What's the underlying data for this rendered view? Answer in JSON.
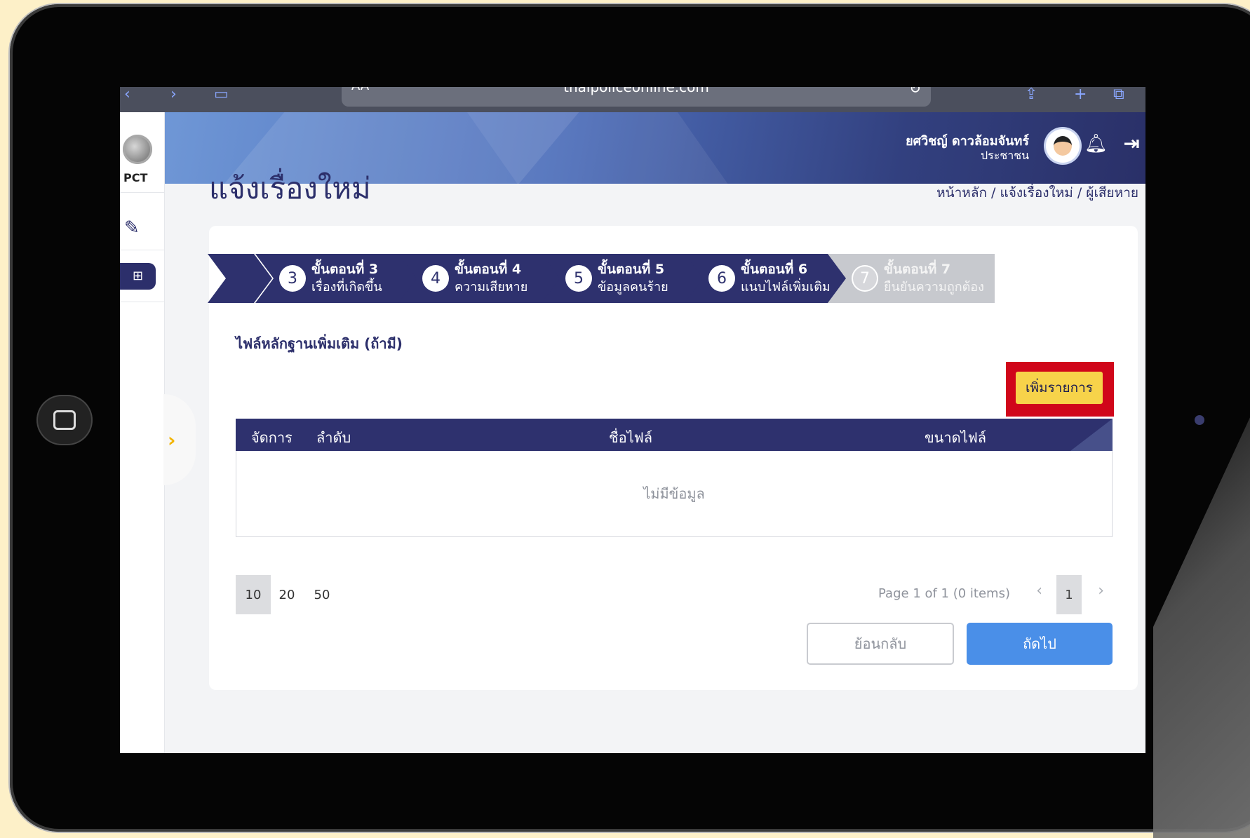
{
  "browser": {
    "text_size_label": "AA",
    "url": "thaipoliceonline.com"
  },
  "sidebar": {
    "logo_label": "PCT"
  },
  "header": {
    "user_name": "ยศวิชญ์ ดาวล้อมจันทร์",
    "user_role": "ประชาชน"
  },
  "page": {
    "title": "แจ้งเรื่องใหม่",
    "breadcrumb": "หน้าหลัก / แจ้งเรื่องใหม่ / ผู้เสียหาย"
  },
  "stepper": {
    "steps": [
      {
        "number": "3",
        "title": "ขั้นตอนที่ 3",
        "subtitle": "เรื่องที่เกิดขึ้น",
        "state": "done"
      },
      {
        "number": "4",
        "title": "ขั้นตอนที่ 4",
        "subtitle": "ความเสียหาย",
        "state": "done"
      },
      {
        "number": "5",
        "title": "ขั้นตอนที่ 5",
        "subtitle": "ข้อมูลคนร้าย",
        "state": "done"
      },
      {
        "number": "6",
        "title": "ขั้นตอนที่ 6",
        "subtitle": "แนบไฟล์เพิ่มเติม",
        "state": "current"
      },
      {
        "number": "7",
        "title": "ขั้นตอนที่ 7",
        "subtitle": "ยืนยันความถูกต้อง",
        "state": "disabled"
      }
    ]
  },
  "section": {
    "title": "ไฟล์หลักฐานเพิ่มเติม (ถ้ามี)",
    "add_button": "เพิ่มรายการ"
  },
  "table": {
    "columns": [
      "จัดการ",
      "ลำดับ",
      "ชื่อไฟล์",
      "ขนาดไฟล์"
    ],
    "empty_text": "ไม่มีข้อมูล"
  },
  "pagination": {
    "page_sizes": [
      "10",
      "20",
      "50"
    ],
    "selected_page_size": "10",
    "info": "Page 1 of 1 (0 items)",
    "current_page": "1"
  },
  "actions": {
    "back_label": "ย้อนกลับ",
    "next_label": "ถัดไป"
  },
  "colors": {
    "primary_navy": "#2e316e",
    "add_button_yellow": "#f7d34a",
    "highlight_red": "#d0061a",
    "next_blue": "#4a8fe8"
  }
}
